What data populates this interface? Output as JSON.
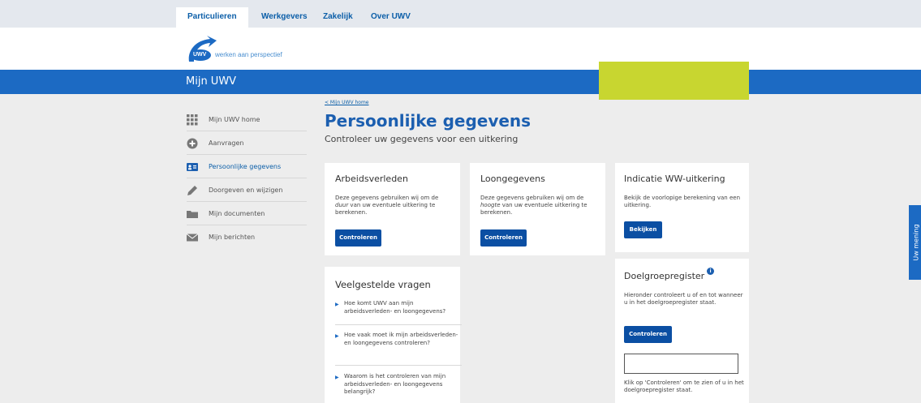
{
  "topnav": {
    "tabs": [
      "Particulieren",
      "Werkgevers",
      "Zakelijk",
      "Over UWV"
    ]
  },
  "logo": {
    "brand": "UWV",
    "tagline": "werken aan perspectief"
  },
  "header": {
    "title": "Mijn UWV"
  },
  "sidebar": {
    "items": [
      {
        "label": "Mijn UWV home",
        "icon": "grid-icon"
      },
      {
        "label": "Aanvragen",
        "icon": "plus-circle-icon"
      },
      {
        "label": "Persoonlijke gegevens",
        "icon": "id-card-icon"
      },
      {
        "label": "Doorgeven en wijzigen",
        "icon": "pencil-icon"
      },
      {
        "label": "Mijn documenten",
        "icon": "folder-icon"
      },
      {
        "label": "Mijn berichten",
        "icon": "envelope-icon"
      }
    ]
  },
  "breadcrumb": "< Mijn UWV home",
  "page": {
    "title": "Persoonlijke gegevens",
    "subtitle": "Controleer uw gegevens voor een uitkering"
  },
  "cards": {
    "arbeidsverleden": {
      "title": "Arbeidsverleden",
      "text_pre": "Deze gegevens gebruiken wij om de ",
      "text_em": "duur",
      "text_post": " van uw eventuele uitkering te berekenen.",
      "button": "Controleren"
    },
    "loongegevens": {
      "title": "Loongegevens",
      "text_pre": "Deze gegevens gebruiken wij om de ",
      "text_em": "hoogte",
      "text_post": " van uw eventuele uitkering te berekenen.",
      "button": "Controleren"
    },
    "indicatie": {
      "title": "Indicatie WW-uitkering",
      "text": "Bekijk de voorlopige berekening van een uitkering.",
      "button": "Bekijken"
    },
    "faq": {
      "title": "Veelgestelde vragen",
      "items": [
        "Hoe komt UWV aan mijn arbeidsverleden- en loongegevens?",
        "Hoe vaak moet ik mijn arbeidsverleden- en loongegevens controleren?",
        "Waarom is het controleren van mijn arbeidsverleden- en loongegevens belangrijk?"
      ]
    },
    "doelgroep": {
      "title": "Doelgroepregister",
      "text": "Hieronder controleert u of en tot wanneer u in het doelgroepregister staat.",
      "button": "Controleren",
      "input_value": "",
      "note": "Klik op 'Controleren' om te zien of u in het doelgroepregister staat."
    }
  },
  "feedback_tab": "Uw mening",
  "colors": {
    "brand_blue": "#1c6ac3",
    "accent_green": "#c8d630",
    "button_blue": "#0b4fa3"
  }
}
